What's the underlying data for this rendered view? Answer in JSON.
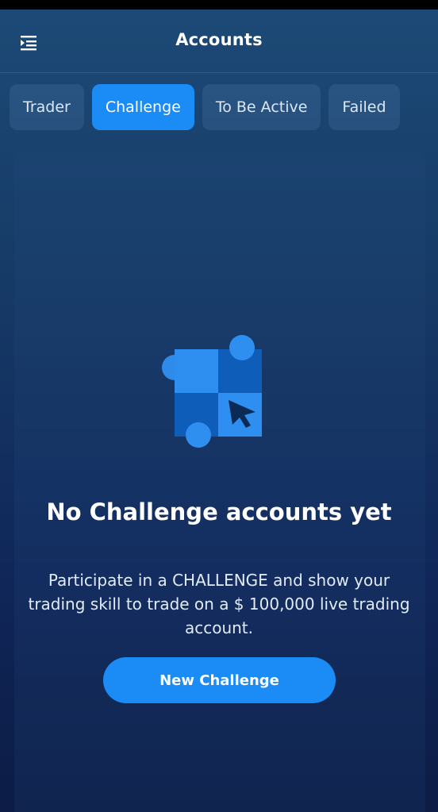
{
  "header": {
    "title": "Accounts",
    "menu_icon": "menu-collapse-icon"
  },
  "tabs": [
    {
      "label": "Trader",
      "active": false
    },
    {
      "label": "Challenge",
      "active": true
    },
    {
      "label": "To Be Active",
      "active": false
    },
    {
      "label": "Failed",
      "active": false
    }
  ],
  "empty_state": {
    "illustration_icon": "checkered-grid-cursor-icon",
    "title": "No Challenge accounts yet",
    "description": "Participate in a CHALLENGE and show your trading skill to trade on a $ 100,000 live trading account.",
    "button_label": "New Challenge"
  },
  "colors": {
    "accent": "#1b8cf5",
    "background_top": "#1d4a77",
    "background_bottom": "#0c1c45"
  }
}
